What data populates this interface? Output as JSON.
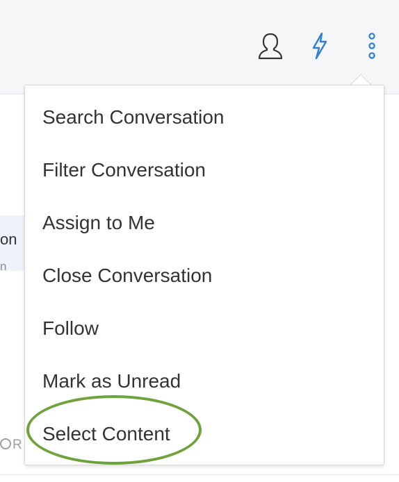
{
  "header": {
    "icons": [
      "user-icon",
      "lightning-bolt-icon",
      "more-vertical-icon"
    ]
  },
  "conversation_list": {
    "visible_title_fragment": "on",
    "visible_subtitle_fragment": "n",
    "visible_bottom_fragment": "R"
  },
  "menu": {
    "items": [
      {
        "label": "Search Conversation"
      },
      {
        "label": "Filter Conversation"
      },
      {
        "label": "Assign to Me"
      },
      {
        "label": "Close Conversation"
      },
      {
        "label": "Follow"
      },
      {
        "label": "Mark as Unread"
      },
      {
        "label": "Select Content"
      }
    ]
  },
  "colors": {
    "header_bg": "#f5f6f7",
    "bolt_blue": "#2e7fd0",
    "highlight_green": "#6fa23b",
    "menu_text": "#333333"
  }
}
